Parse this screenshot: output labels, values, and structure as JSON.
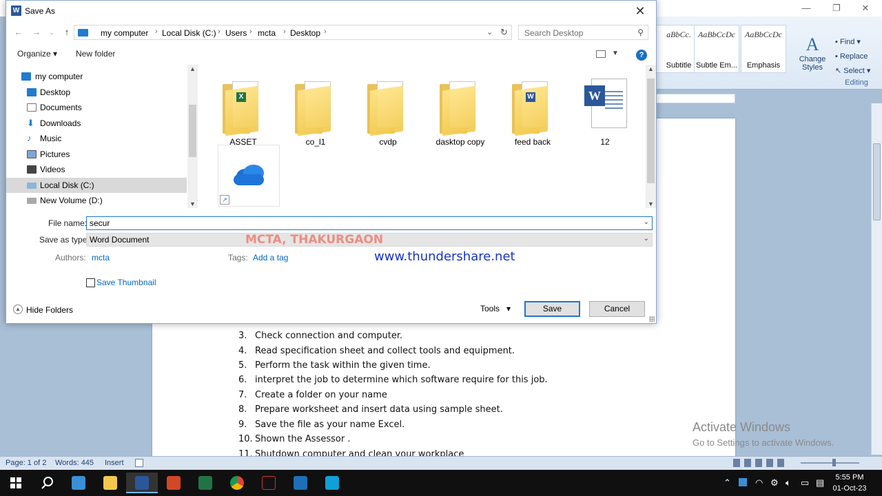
{
  "dialog": {
    "title": "Save As",
    "breadcrumb": [
      "my computer",
      "Local Disk (C:)",
      "Users",
      "mcta",
      "Desktop"
    ],
    "search_placeholder": "Search Desktop",
    "toolbar": {
      "organize": "Organize",
      "new_folder": "New folder",
      "help": "?"
    },
    "nav_items": [
      {
        "label": "my computer",
        "icon": "computer-icon",
        "selected": false
      },
      {
        "label": "Desktop",
        "icon": "desktop-icon",
        "selected": false
      },
      {
        "label": "Documents",
        "icon": "documents-icon",
        "selected": false
      },
      {
        "label": "Downloads",
        "icon": "downloads-icon",
        "selected": false
      },
      {
        "label": "Music",
        "icon": "music-icon",
        "selected": false
      },
      {
        "label": "Pictures",
        "icon": "pictures-icon",
        "selected": false
      },
      {
        "label": "Videos",
        "icon": "videos-icon",
        "selected": false
      },
      {
        "label": "Local Disk (C:)",
        "icon": "drive-icon",
        "selected": true
      },
      {
        "label": "New Volume (D:)",
        "icon": "drive-icon",
        "selected": false
      }
    ],
    "files": [
      {
        "name": "ASSET",
        "type": "folder"
      },
      {
        "name": "co_l1",
        "type": "folder"
      },
      {
        "name": "cvdp",
        "type": "folder"
      },
      {
        "name": "dasktop copy",
        "type": "folder"
      },
      {
        "name": "feed back",
        "type": "folder"
      },
      {
        "name": "12",
        "type": "word-document"
      },
      {
        "name": "",
        "type": "onedrive-shortcut"
      }
    ],
    "file_name_label": "File name:",
    "file_name_value": "secur",
    "save_as_type_label": "Save as type:",
    "save_as_type_value": "Word Document",
    "authors_label": "Authors:",
    "authors_value": "mcta",
    "tags_label": "Tags:",
    "tags_value": "Add a tag",
    "save_thumbnail_label": "Save Thumbnail",
    "hide_folders_label": "Hide Folders",
    "tools_label": "Tools",
    "save_label": "Save",
    "cancel_label": "Cancel"
  },
  "watermarks": {
    "line1": "MCTA, THAKURGAON",
    "line2": "www.thundershare.net"
  },
  "ribbon": {
    "styles": [
      {
        "sample": "aBbCc.",
        "name": "Subtitle"
      },
      {
        "sample": "AaBbCcDc",
        "name": "Subtle Em..."
      },
      {
        "sample": "AaBbCcDc",
        "name": "Emphasis"
      }
    ],
    "change_styles": "Change Styles",
    "find": "Find",
    "replace": "Replace",
    "select": "Select",
    "group_label": "Editing"
  },
  "document": {
    "items": [
      {
        "n": "3.",
        "text": "Check connection  and  computer."
      },
      {
        "n": "4.",
        "text": "Read specification sheet and collect tools and equipment."
      },
      {
        "n": "5.",
        "text": "Perform the task within the given time."
      },
      {
        "n": "6.",
        "text": "interpret the job to determine which software require for this job."
      },
      {
        "n": "7.",
        "text": "Create a folder on your name"
      },
      {
        "n": "8.",
        "text": "Prepare worksheet  and insert data using sample sheet."
      },
      {
        "n": "9.",
        "text": "Save the file as your name Excel."
      },
      {
        "n": "10.",
        "text": "Shown the Assessor ."
      },
      {
        "n": "11.",
        "text": "Shutdown computer and clean your workplace"
      }
    ]
  },
  "activation": {
    "title": "Activate Windows",
    "subtitle": "Go to Settings to activate Windows."
  },
  "statusbar": {
    "page": "Page: 1 of 2",
    "words": "Words: 445",
    "mode": "Insert"
  },
  "taskbar": {
    "time": "5:55 PM",
    "date": "01-Oct-23"
  },
  "colors": {
    "accent": "#1e78c8",
    "word_blue": "#2b579a",
    "folder": "#f2c94c",
    "selection": "#d9d9d9"
  }
}
